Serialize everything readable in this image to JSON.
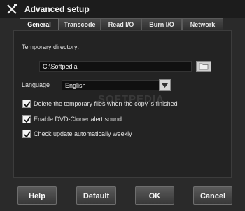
{
  "window": {
    "title": "Advanced setup",
    "icon": "tools-icon"
  },
  "tabs": [
    {
      "label": "General",
      "active": true
    },
    {
      "label": "Transcode",
      "active": false
    },
    {
      "label": "Read I/O",
      "active": false
    },
    {
      "label": "Burn I/O",
      "active": false
    },
    {
      "label": "Network",
      "active": false
    }
  ],
  "general": {
    "temp_dir_label": "Temporary directory:",
    "temp_dir_value": "C:\\Softpedia",
    "browse_icon": "folder-icon",
    "language_label": "Language",
    "language_value": "English",
    "options": [
      {
        "label": "Delete the temporary files when the copy is finished",
        "checked": true
      },
      {
        "label": "Enable DVD-Cloner alert sound",
        "checked": true
      },
      {
        "label": "Check update automatically weekly",
        "checked": true
      }
    ],
    "watermark": "SOFTPEDIA"
  },
  "buttons": {
    "help": "Help",
    "default": "Default",
    "ok": "OK",
    "cancel": "Cancel"
  },
  "colors": {
    "background": "#2a2a2a",
    "titlebar": "#1c1c1c",
    "panel": "#232323",
    "text": "#e8e8e8"
  }
}
